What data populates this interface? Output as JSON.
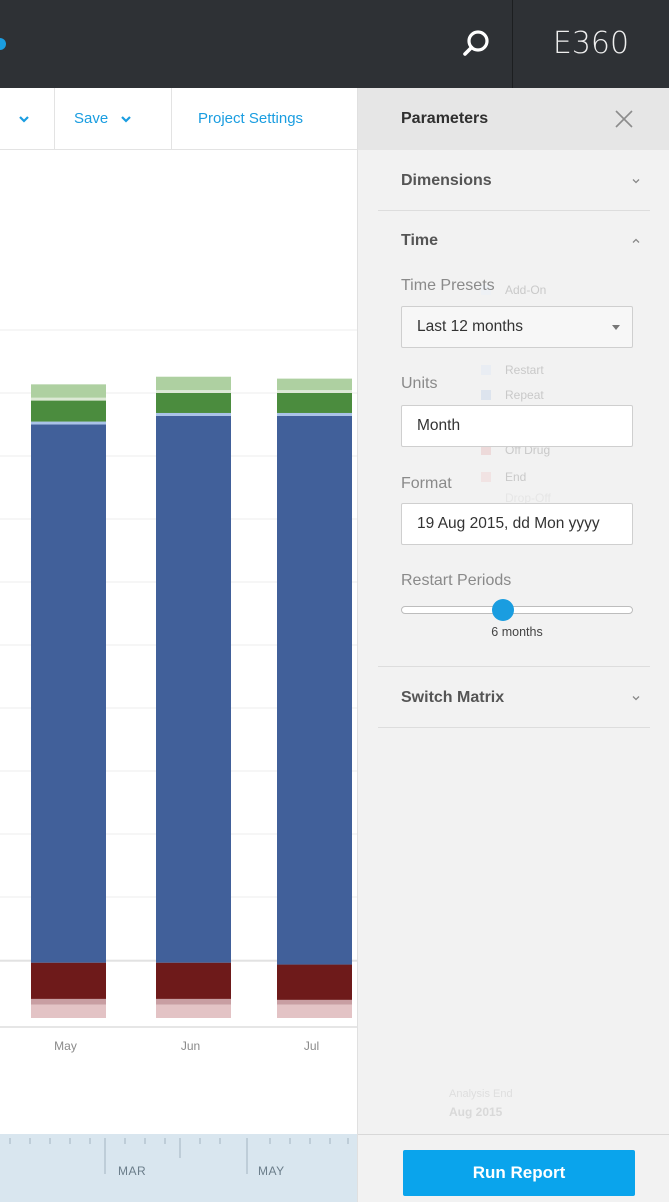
{
  "header": {
    "app_name": "E360"
  },
  "toolbar": {
    "save_label": "Save",
    "project_settings_label": "Project Settings"
  },
  "chart_data": {
    "type": "bar",
    "stacked": true,
    "categories": [
      "May",
      "Jun",
      "Jul"
    ],
    "series": [
      {
        "key": "off-drug-light",
        "color": "#e3c3c5",
        "values": [
          14,
          14,
          14
        ]
      },
      {
        "key": "off-drug",
        "color": "#c89ea2",
        "values": [
          6,
          6,
          5
        ]
      },
      {
        "key": "end",
        "color": "#6e1a1a",
        "values": [
          38,
          38,
          37
        ]
      },
      {
        "key": "continuing",
        "color": "#41609a",
        "values": [
          564,
          573,
          575
        ]
      },
      {
        "key": "repeat-edge",
        "color": "#a9c3e8",
        "values": [
          3,
          3,
          3
        ]
      },
      {
        "key": "switch",
        "color": "#4b8c3e",
        "values": [
          22,
          21,
          21
        ]
      },
      {
        "key": "add-on-edge",
        "color": "#dce9d5",
        "values": [
          3,
          3,
          3
        ]
      },
      {
        "key": "add-on",
        "color": "#aed0a1",
        "values": [
          14,
          14,
          12
        ]
      }
    ],
    "ylim": [
      0,
      700
    ],
    "grid": true
  },
  "timeline": {
    "labels": [
      "MAR",
      "MAY"
    ]
  },
  "panel": {
    "title": "Parameters",
    "sections": {
      "dimensions": "Dimensions",
      "time": "Time",
      "switch_matrix": "Switch Matrix"
    },
    "time_presets": {
      "label": "Time Presets",
      "value": "Last 12 months"
    },
    "units": {
      "label": "Units",
      "value": "Month"
    },
    "format": {
      "label": "Format",
      "value": "19 Aug 2015, dd Mon yyyy"
    },
    "restart_periods": {
      "label": "Restart Periods",
      "value_label": "6 months",
      "fraction": 0.44
    },
    "run_report_label": "Run Report"
  },
  "ghost_legend": {
    "items": [
      "Add-On",
      "Restart",
      "Repeat",
      "Off Drug",
      "End",
      "Drop-Off"
    ],
    "analysis_end_label": "Analysis End",
    "analysis_end_value": "Aug 2015"
  },
  "colors": {
    "accent": "#1a9de0",
    "topbar": "#2e3135",
    "panel": "#f2f2f2"
  }
}
